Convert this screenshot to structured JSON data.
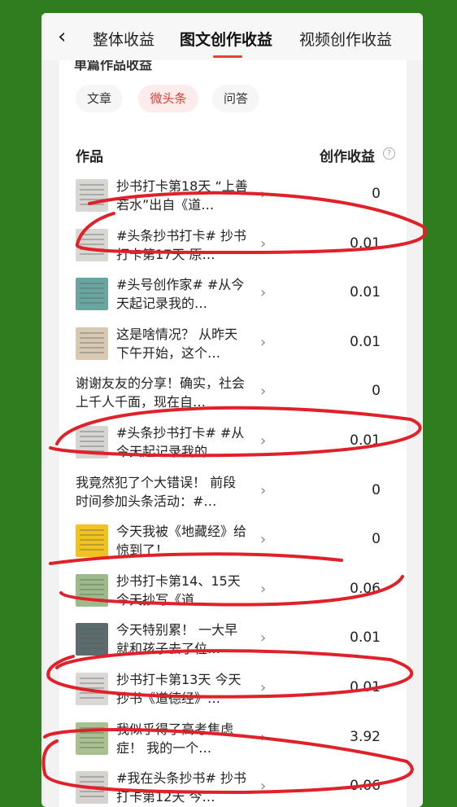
{
  "header": {
    "tabs": [
      {
        "label": "整体收益"
      },
      {
        "label": "图文创作收益"
      },
      {
        "label": "视频创作收益"
      }
    ]
  },
  "section": {
    "title": "单篇作品收益",
    "chips": [
      {
        "label": "文章"
      },
      {
        "label": "微头条"
      },
      {
        "label": "问答"
      }
    ],
    "col_works": "作品",
    "col_earnings": "创作收益"
  },
  "rows": [
    {
      "title": "抄书打卡第18天 “上善若水”出自《道…",
      "value": "0",
      "thumb": "#d8d6d2"
    },
    {
      "title": "#头条抄书打卡# 抄书打卡第17天 原…",
      "value": "0.01",
      "thumb": "#d9d7d4"
    },
    {
      "title": "#头号创作家# #从今天起记录我的…",
      "value": "0.01",
      "thumb": "#6aa6a1"
    },
    {
      "title": "这是啥情况？ 从昨天下午开始，这个…",
      "value": "0.01",
      "thumb": "#d8c9b2"
    },
    {
      "title": "谢谢友友的分享！确实，社会上千人千面，现在自…",
      "value": "0",
      "thumb": ""
    },
    {
      "title": "#头条抄书打卡# #从今天起记录我的…",
      "value": "0.01",
      "thumb": "#d7d5d1"
    },
    {
      "title": "我竟然犯了个大错误！ 前段时间参加头条活动：#…",
      "value": "0",
      "thumb": ""
    },
    {
      "title": "今天我被《地藏经》给惊到了！ …",
      "value": "0",
      "thumb": "#f2c21e"
    },
    {
      "title": "抄书打卡第14、15天 今天抄写《道…",
      "value": "0.06",
      "thumb": "#9dbb8a"
    },
    {
      "title": "今天特别累！ 一大早就和孩子去了位…",
      "value": "0.01",
      "thumb": "#5c6b6e"
    },
    {
      "title": "抄书打卡第13天 今天抄书《道德经》…",
      "value": "0.01",
      "thumb": "#dad8d5"
    },
    {
      "title": "我似乎得了高考焦虑症！ 我的一个…",
      "value": "3.92",
      "thumb": "#a9c08f"
    },
    {
      "title": "#我在头条抄书# 抄书打卡第12天 今…",
      "value": "0.06",
      "thumb": "#d6d3cf"
    }
  ],
  "annotation_color": "#e0212a"
}
